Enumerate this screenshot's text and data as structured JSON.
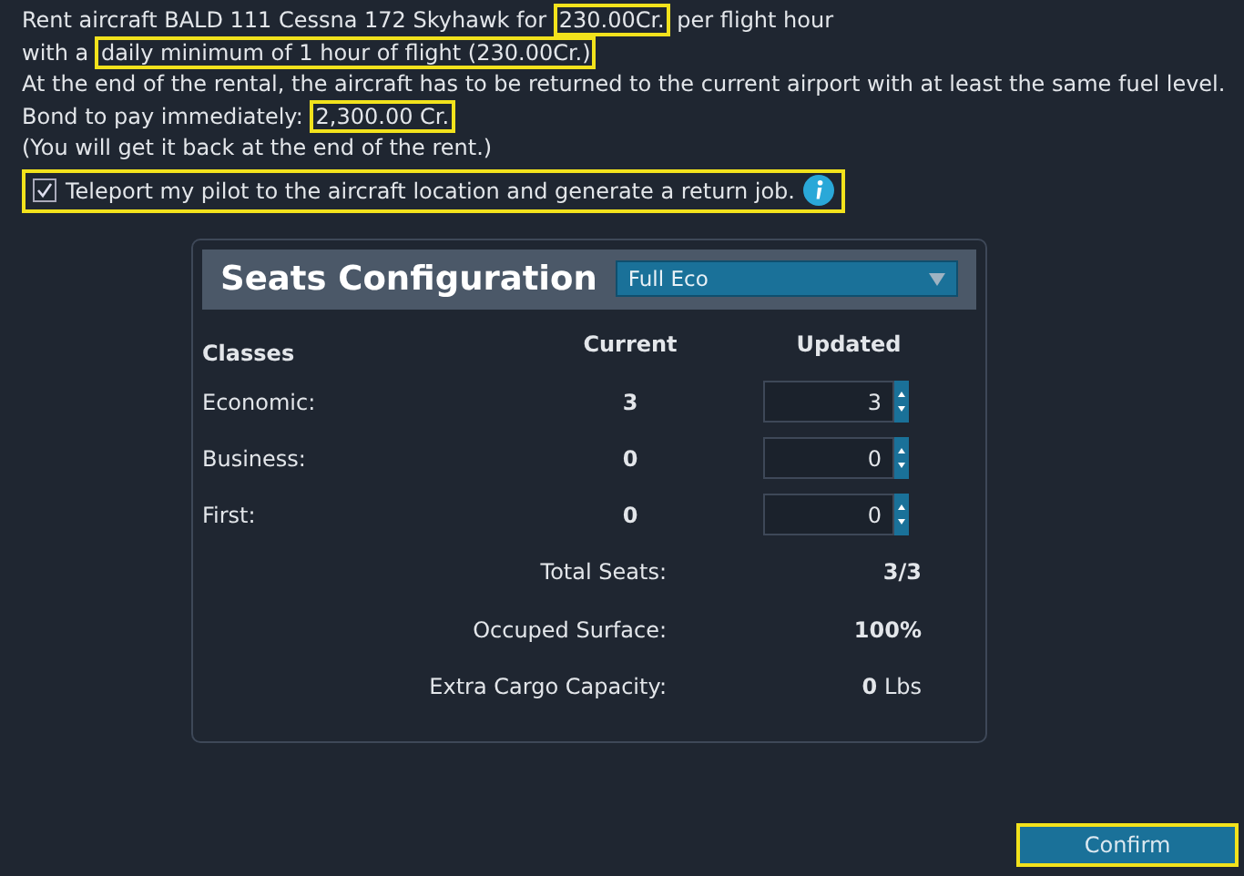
{
  "info_lines": [
    {
      "segments": [
        {
          "text": "Rent aircraft BALD 111 Cessna 172 Skyhawk for ",
          "highlighted": false
        },
        {
          "text": "230.00Cr.",
          "highlighted": true
        },
        {
          "text": " per flight hour",
          "highlighted": false
        }
      ]
    },
    {
      "segments": [
        {
          "text": "with a ",
          "highlighted": false
        },
        {
          "text": "daily minimum of 1 hour of flight (230.00Cr.)",
          "highlighted": true
        }
      ]
    },
    {
      "segments": [
        {
          "text": "At the end of the rental, the aircraft has to be returned to the current airport with at least the same fuel level.",
          "highlighted": false
        }
      ]
    },
    {
      "segments": [
        {
          "text": "Bond to pay immediately: ",
          "highlighted": false
        },
        {
          "text": "2,300.00 Cr.",
          "highlighted": true
        }
      ]
    },
    {
      "segments": [
        {
          "text": "(You will get it back at the end of the rent.)",
          "highlighted": false
        }
      ]
    }
  ],
  "teleport": {
    "label": "Teleport my pilot to the aircraft location and generate a return job.",
    "checked": true,
    "highlighted": true
  },
  "seats": {
    "title": "Seats Configuration",
    "preset": "Full Eco",
    "columns": [
      "Classes",
      "Current",
      "Updated"
    ],
    "rows": [
      {
        "name": "Economic:",
        "current": "3",
        "updated": "3"
      },
      {
        "name": "Business:",
        "current": "0",
        "updated": "0"
      },
      {
        "name": "First:",
        "current": "0",
        "updated": "0"
      }
    ],
    "totals": [
      {
        "label": "Total Seats:",
        "value": "**3/3**"
      },
      {
        "label": "Occuped Surface:",
        "value": "**100%**"
      },
      {
        "label": "Extra Cargo Capacity:",
        "value": "**0** Lbs"
      }
    ]
  },
  "confirm": {
    "label": "Confirm",
    "highlighted": true
  }
}
